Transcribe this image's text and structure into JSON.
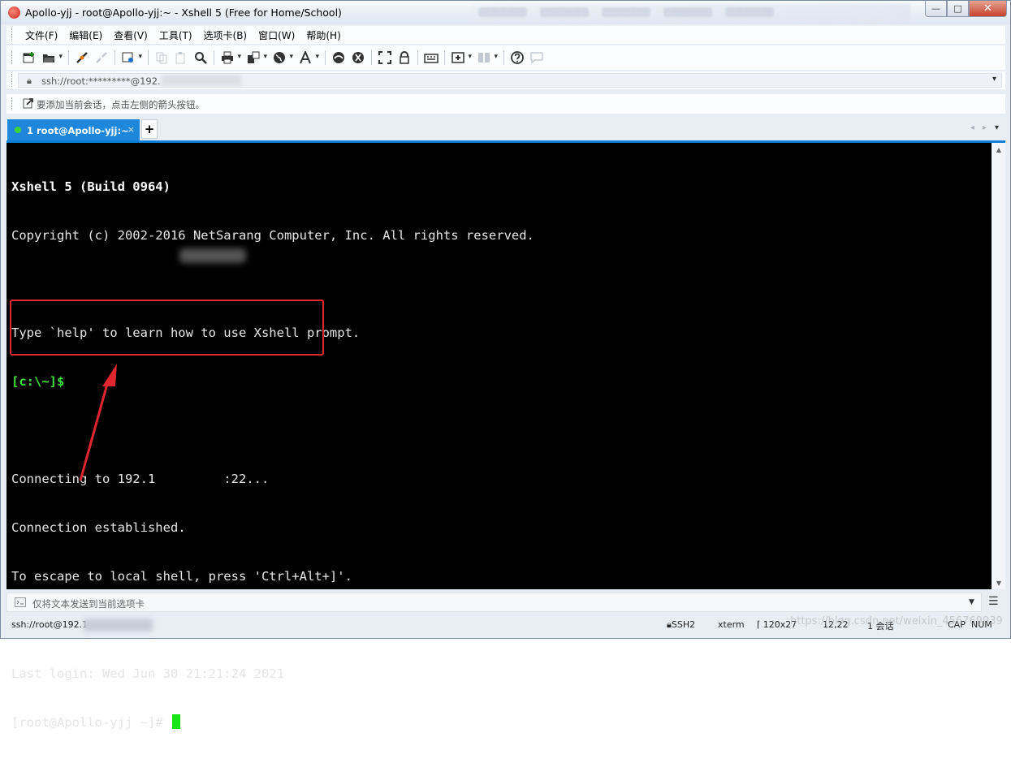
{
  "window": {
    "title": "Apollo-yjj - root@Apollo-yjj:~ - Xshell 5 (Free for Home/School)",
    "buttons": {
      "minimize": "—",
      "maximize": "□",
      "close": "✕"
    }
  },
  "menu": [
    "文件(F)",
    "编辑(E)",
    "查看(V)",
    "工具(T)",
    "选项卡(B)",
    "窗口(W)",
    "帮助(H)"
  ],
  "toolbar": {
    "icons": [
      "new-session-icon",
      "open-folder-icon",
      "connect-icon",
      "disconnect-icon",
      "properties-icon",
      "copy-icon",
      "paste-icon",
      "find-icon",
      "print-icon",
      "transfer-icon",
      "globe-icon",
      "font-icon",
      "xftp-icon",
      "xmanager-icon",
      "fullscreen-icon",
      "lock-icon",
      "keyboard-icon",
      "new-tab-icon",
      "layout-icon",
      "help-icon",
      "chat-icon"
    ]
  },
  "address": {
    "text": "ssh://root:*********@192.",
    "dropdown": "▾"
  },
  "session_hint": {
    "text": "要添加当前会话，点击左侧的箭头按钮。"
  },
  "tabs": [
    {
      "label": "1 root@Apollo-yjj:~",
      "active": true,
      "close": "×"
    }
  ],
  "tab_add": "+",
  "tab_nav": {
    "prev": "◂",
    "next": "▸",
    "menu": "▾"
  },
  "terminal": {
    "banner_title": "Xshell 5 (Build 0964)",
    "banner_copyright": "Copyright (c) 2002-2016 NetSarang Computer, Inc. All rights reserved.",
    "help_line": "Type `help' to learn how to use Xshell prompt.",
    "local_prompt": "[c:\\~]$",
    "connecting_prefix": "Connecting to 192.1",
    "connecting_suffix": ":22...",
    "established": "Connection established.",
    "escape_hint": "To escape to local shell, press 'Ctrl+Alt+]'.",
    "last_login": "Last login: Wed Jun 30 21:21:24 2021",
    "remote_prompt": "[root@Apollo-yjj ~]# "
  },
  "compose": {
    "text": "仅将文本发送到当前选项卡"
  },
  "status": {
    "address": "ssh://root@192.1",
    "protocol": "SSH2",
    "terminal_type": "xterm",
    "size": "120x27",
    "cursor": "12,22",
    "sessions": "1 会话",
    "caps": "CAP",
    "num": "NUM"
  },
  "watermark": "https://blog.csdn.net/weixin_456769939"
}
